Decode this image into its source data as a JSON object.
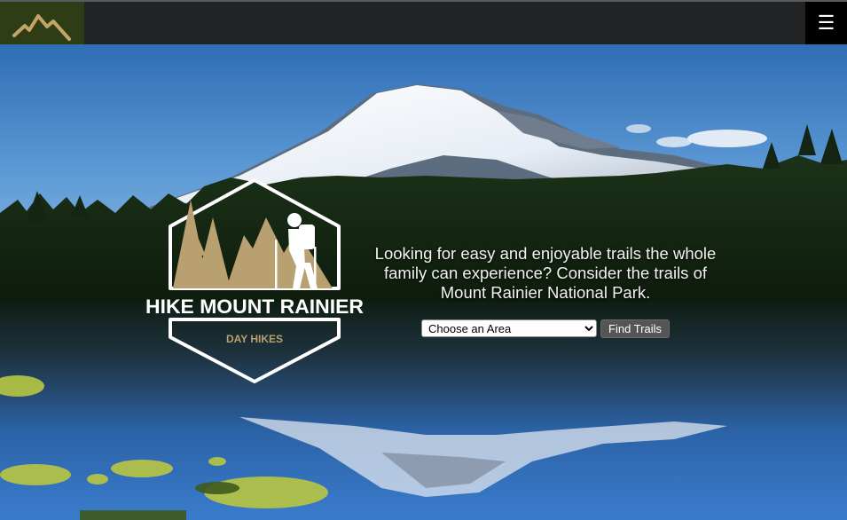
{
  "header": {
    "logo_icon": "mountain-logo-icon",
    "menu_icon": "hamburger-menu-icon",
    "menu_glyph": "☰",
    "logo_color": "#c2a567"
  },
  "hero": {
    "badge": {
      "title": "HIKE MOUNT RAINIER",
      "subtitle": "DAY HIKES",
      "accent_color": "#b9a070"
    },
    "tagline": "Looking for easy and enjoyable trails the whole family can experience? Consider the trails of Mount Rainier National Park.",
    "search": {
      "select_value": "Choose an Area",
      "button_label": "Find Trails"
    }
  }
}
